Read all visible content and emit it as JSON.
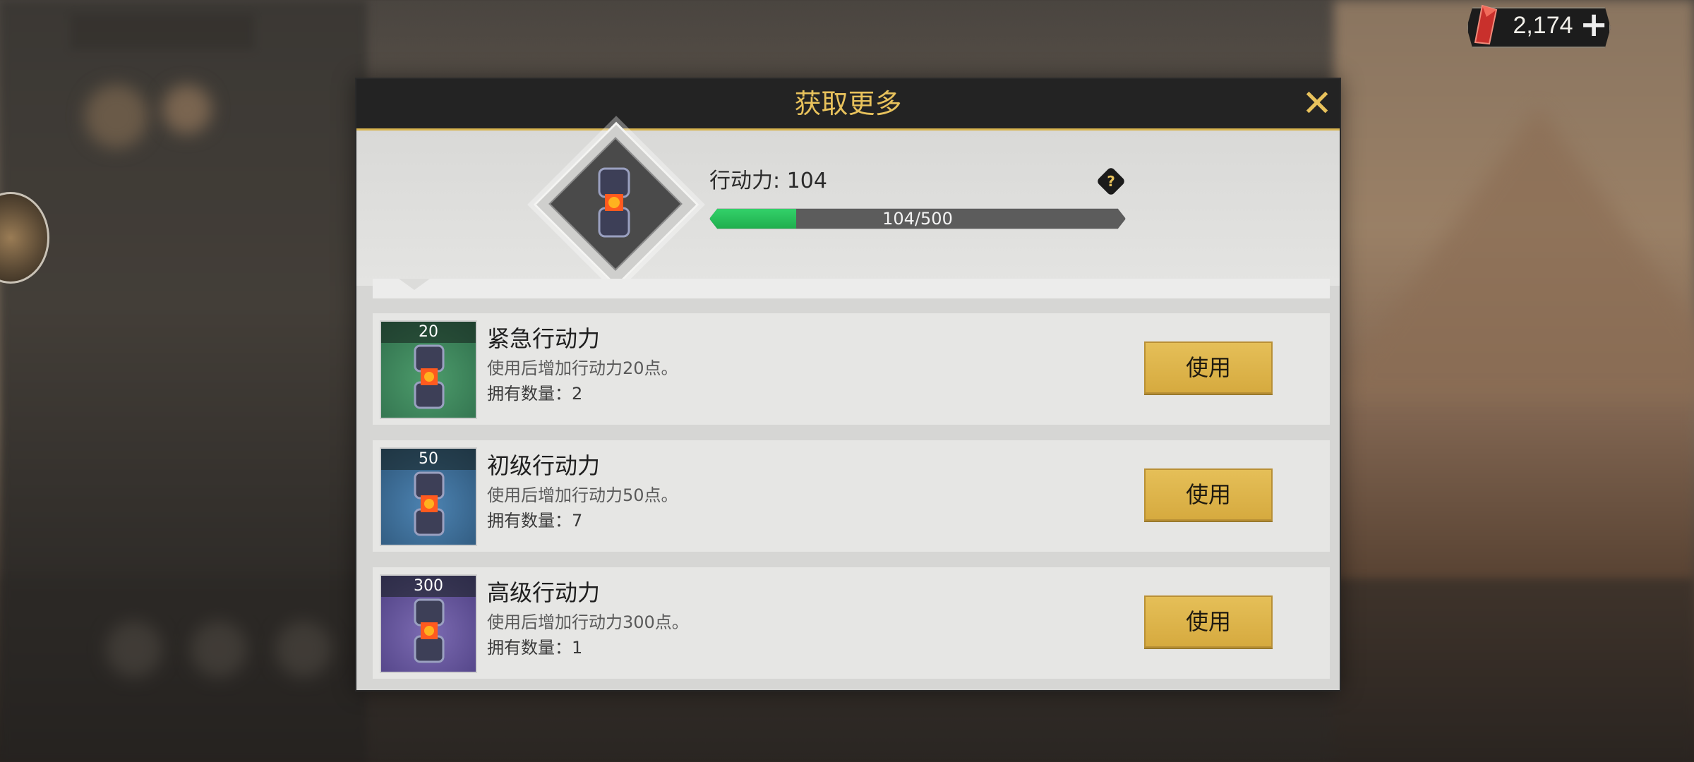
{
  "currency": {
    "amount": "2,174",
    "plus_icon": "plus-icon",
    "gem_icon": "red-crystal-icon"
  },
  "dialog": {
    "title": "获取更多",
    "close_icon": "close-icon",
    "summary": {
      "label": "行动力: 104",
      "progress_text": "104/500",
      "progress_fraction": 0.208,
      "help_icon": "help-icon",
      "help_glyph": "?"
    },
    "items": [
      {
        "badge": "20",
        "name": "紧急行动力",
        "desc": "使用后增加行动力20点。",
        "qty": "拥有数量：2",
        "button": "使用"
      },
      {
        "badge": "50",
        "name": "初级行动力",
        "desc": "使用后增加行动力50点。",
        "qty": "拥有数量：7",
        "button": "使用"
      },
      {
        "badge": "300",
        "name": "高级行动力",
        "desc": "使用后增加行动力300点。",
        "qty": "拥有数量：1",
        "button": "使用"
      }
    ]
  },
  "colors": {
    "accent_gold": "#e8c25c",
    "button_gold": "#d6aa3f",
    "progress_green": "#1fae4d",
    "header_dark": "#232323"
  }
}
